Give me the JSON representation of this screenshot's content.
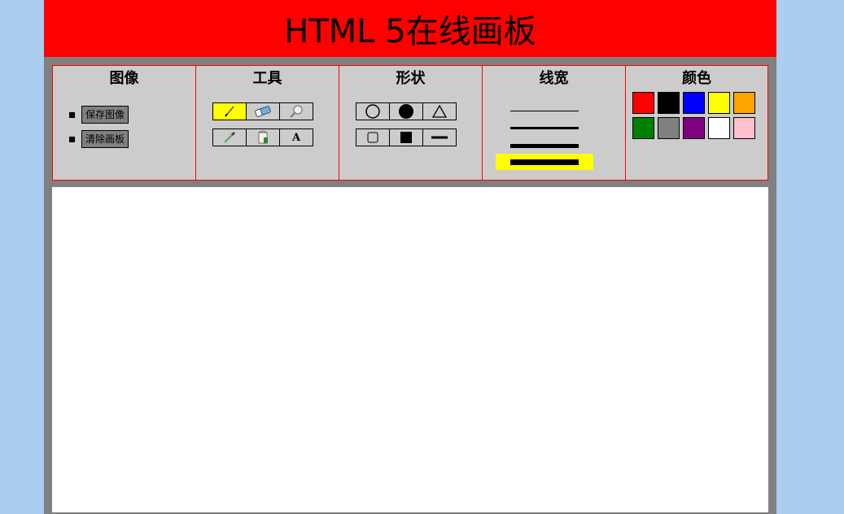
{
  "header": {
    "title": "HTML 5在线画板"
  },
  "panels": {
    "image": {
      "title": "图像",
      "save_label": "保存图像",
      "clear_label": "清除画板"
    },
    "tools": {
      "title": "工具",
      "items": [
        "pencil-icon",
        "eraser-icon",
        "magnifier-icon",
        "eyedropper-icon",
        "paint-bucket-icon",
        "text-icon"
      ],
      "text_glyph": "A",
      "active": "pencil-icon"
    },
    "shapes": {
      "title": "形状",
      "items": [
        "circle-outline",
        "circle-filled",
        "triangle-outline",
        "square-outline",
        "square-filled",
        "line"
      ]
    },
    "linewidth": {
      "title": "线宽",
      "options": [
        1,
        3,
        5,
        7
      ],
      "active_index": 3
    },
    "colors": {
      "title": "颜色",
      "swatches": [
        "#ff0000",
        "#000000",
        "#0000ff",
        "#ffff00",
        "#ffa500",
        "#008000",
        "#808080",
        "#800080",
        "#ffffff",
        "#ffc0cb"
      ]
    }
  },
  "colors": {
    "page_bg": "#abcdef",
    "header_bg": "#ff0000",
    "toolbar_bg": "#cccccc",
    "frame_bg": "#808080",
    "active_highlight": "#ffff00"
  }
}
